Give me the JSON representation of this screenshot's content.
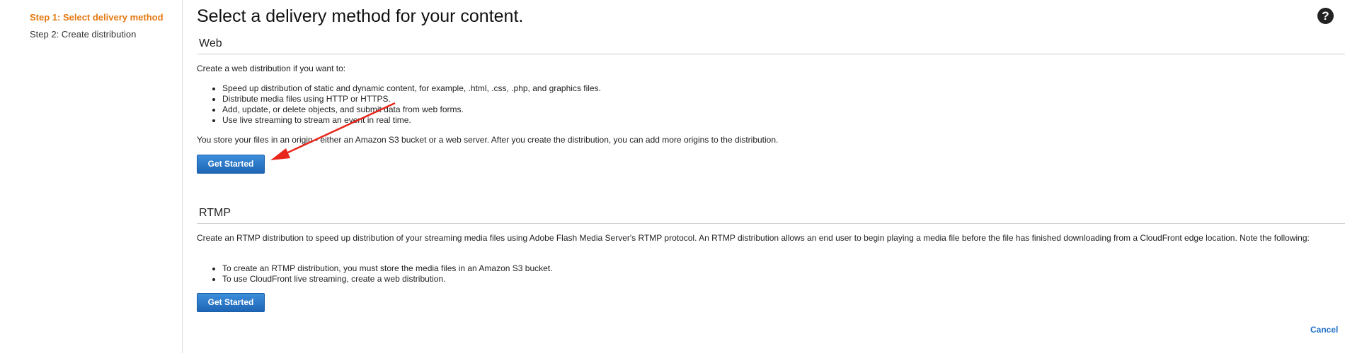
{
  "sidebar": {
    "steps": [
      {
        "label": "Step 1: Select delivery method"
      },
      {
        "label": "Step 2: Create distribution"
      }
    ]
  },
  "page": {
    "title": "Select a delivery method for your content.",
    "help_icon": "question-circle-icon"
  },
  "web": {
    "title": "Web",
    "intro": "Create a web distribution if you want to:",
    "bullets": [
      "Speed up distribution of static and dynamic content, for example, .html, .css, .php, and graphics files.",
      "Distribute media files using HTTP or HTTPS.",
      "Add, update, or delete objects, and submit data from web forms.",
      "Use live streaming to stream an event in real time."
    ],
    "note": "You store your files in an origin - either an Amazon S3 bucket or a web server. After you create the distribution, you can add more origins to the distribution.",
    "button_label": "Get Started"
  },
  "rtmp": {
    "title": "RTMP",
    "intro": "Create an RTMP distribution to speed up distribution of your streaming media files using Adobe Flash Media Server's RTMP protocol. An RTMP distribution allows an end user to begin playing a media file before the file has finished downloading from a CloudFront edge location. Note the following:",
    "bullets": [
      "To create an RTMP distribution, you must store the media files in an Amazon S3 bucket.",
      "To use CloudFront live streaming, create a web distribution."
    ],
    "button_label": "Get Started"
  },
  "footer": {
    "cancel_label": "Cancel"
  },
  "colors": {
    "active_step": "#e47911",
    "button": "#1e66b5",
    "link": "#1f6fc6",
    "annotation_arrow": "#e8261c"
  }
}
